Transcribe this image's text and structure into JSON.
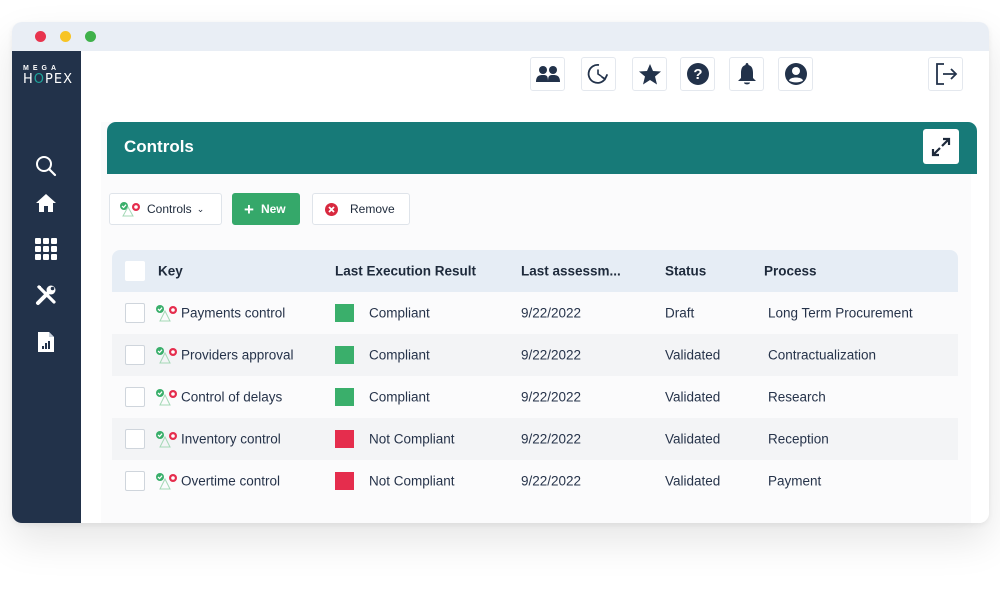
{
  "app": {
    "logo_top": "MEGA",
    "logo_bottom_pre": "H",
    "logo_bottom_o": "O",
    "logo_bottom_post": "PEX"
  },
  "colors": {
    "sidebar_bg": "#22324a",
    "panel_header": "#177a78",
    "new_button": "#35a86a",
    "compliant": "#3aaf6b",
    "not_compliant": "#e52d4d",
    "remove_icon": "#d8293f"
  },
  "sidebar": {
    "items": [
      {
        "icon": "search-icon",
        "label": "Search"
      },
      {
        "icon": "home-icon",
        "label": "Home"
      },
      {
        "icon": "grid-icon",
        "label": "Apps"
      },
      {
        "icon": "tools-icon",
        "label": "Tools"
      },
      {
        "icon": "report-icon",
        "label": "Reports"
      }
    ]
  },
  "topbar": {
    "buttons": [
      {
        "icon": "users-icon"
      },
      {
        "icon": "history-icon"
      },
      {
        "icon": "star-icon"
      },
      {
        "icon": "help-icon"
      },
      {
        "icon": "bell-icon"
      },
      {
        "icon": "user-account-icon"
      }
    ],
    "logout_icon": "logout-icon"
  },
  "panel": {
    "title": "Controls",
    "expand_icon": "expand-icon"
  },
  "toolbar": {
    "controls_label": "Controls",
    "new_label": "New",
    "remove_label": "Remove"
  },
  "table": {
    "headers": {
      "key": "Key",
      "last_execution_result": "Last Execution Result",
      "last_assessment": "Last assessm...",
      "status": "Status",
      "process": "Process"
    },
    "rows": [
      {
        "key": "Payments control",
        "result": "Compliant",
        "result_status": "compliant",
        "date": "9/22/2022",
        "status": "Draft",
        "process": "Long Term Procurement"
      },
      {
        "key": "Providers approval",
        "result": "Compliant",
        "result_status": "compliant",
        "date": "9/22/2022",
        "status": "Validated",
        "process": "Contractualization"
      },
      {
        "key": "Control of delays",
        "result": "Compliant",
        "result_status": "compliant",
        "date": "9/22/2022",
        "status": "Validated",
        "process": "Research"
      },
      {
        "key": "Inventory control",
        "result": "Not Compliant",
        "result_status": "not_compliant",
        "date": "9/22/2022",
        "status": "Validated",
        "process": "Reception"
      },
      {
        "key": "Overtime control",
        "result": "Not Compliant",
        "result_status": "not_compliant",
        "date": "9/22/2022",
        "status": "Validated",
        "process": "Payment"
      }
    ]
  }
}
